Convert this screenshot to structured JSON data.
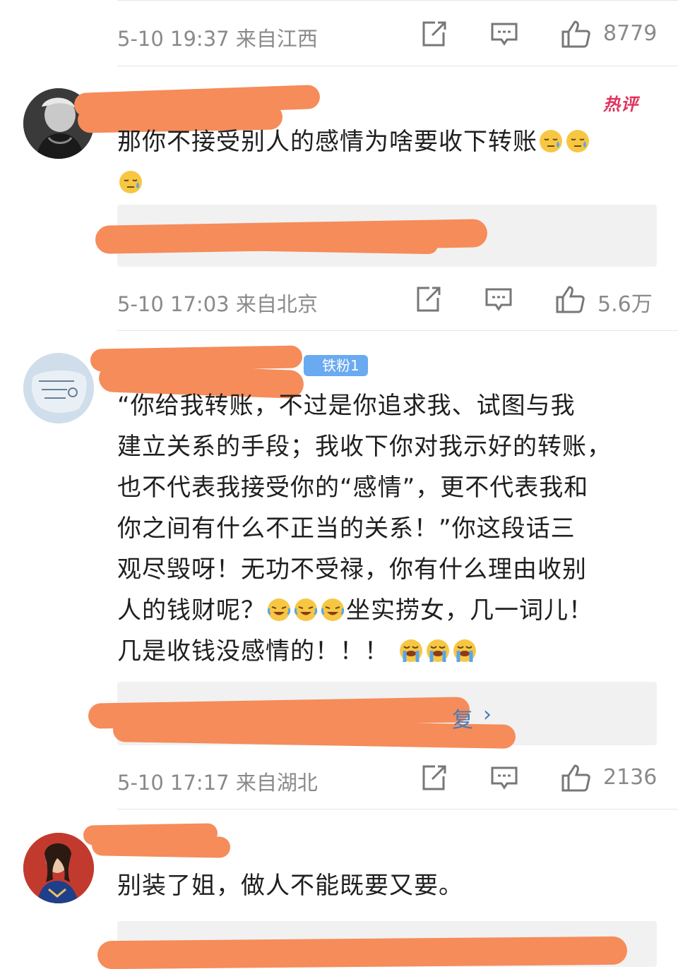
{
  "comments": [
    {
      "time": "5-10 19:37",
      "location": "来自江西",
      "likes": "8779"
    },
    {
      "badge": "热评",
      "text_line1": "那你不接受别人的感情为啥要收下转账",
      "emoji_line1": [
        "sweat-face-emoji",
        "sweat-face-emoji"
      ],
      "emoji_line2": [
        "sweat-face-emoji"
      ],
      "time": "5-10 17:03",
      "location": "来自北京",
      "likes": "5.6万"
    },
    {
      "fan_badge": "铁粉1",
      "lines": [
        "“你给我转账，不过是你追求我、试图与我",
        "建立关系的手段；我收下你对我示好的转账，",
        "也不代表我接受你的“感情”，更不代表我和",
        "你之间有什么不正当的关系！”你这段话三",
        "观尽毁呀！无功不受禄，你有什么理由收别"
      ],
      "line6_start": "人的钱财呢？",
      "line6_end": "坐实捞女，几一词儿！",
      "line7": "几是收钱没感情的！！！",
      "reply_partial": "复",
      "time": "5-10 17:17",
      "location": "来自湖北",
      "likes": "2136"
    },
    {
      "text": "别装了姐，做人不能既要又要。"
    }
  ],
  "icons": {
    "repost": "repost-icon",
    "comment": "comment-icon",
    "like": "thumbs-up-icon"
  },
  "colors": {
    "hot_badge": "#e0335f",
    "fan_badge": "#6aaaf0",
    "redaction": "#f58c5a",
    "meta_text": "#8a8a8a"
  }
}
